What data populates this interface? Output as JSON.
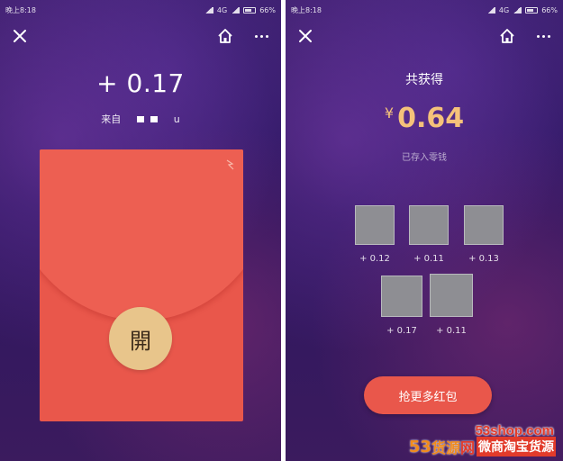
{
  "left_screen": {
    "status": {
      "time": "晚上8:18",
      "network": "4G",
      "battery": "66%"
    },
    "amount": "+ 0.17",
    "from_label": "来自",
    "from_name_partial": "u",
    "open_button_label": "開",
    "envelope_color": "#e9574b",
    "open_button_color": "#e8c58b"
  },
  "right_screen": {
    "status": {
      "time": "晚上8:18",
      "network": "4G",
      "battery": "66%"
    },
    "total_title": "共获得",
    "currency": "¥",
    "total_amount": "0.64",
    "saved_note": "已存入零钱",
    "gifts": [
      {
        "amount": "+ 0.12"
      },
      {
        "amount": "+ 0.11"
      },
      {
        "amount": "+ 0.13"
      },
      {
        "amount": "+ 0.17"
      },
      {
        "amount": "+ 0.11"
      }
    ],
    "more_button_label": "抢更多红包",
    "accent_gold": "#f5c27a",
    "button_color": "#e9574b"
  },
  "watermark": {
    "url": "53shop.com",
    "brand_number": "53",
    "brand_name": "货源",
    "brand_net": "网",
    "brand_sub": "微商淘宝货源"
  },
  "icons": [
    "close-icon",
    "home-icon",
    "more-icon"
  ]
}
